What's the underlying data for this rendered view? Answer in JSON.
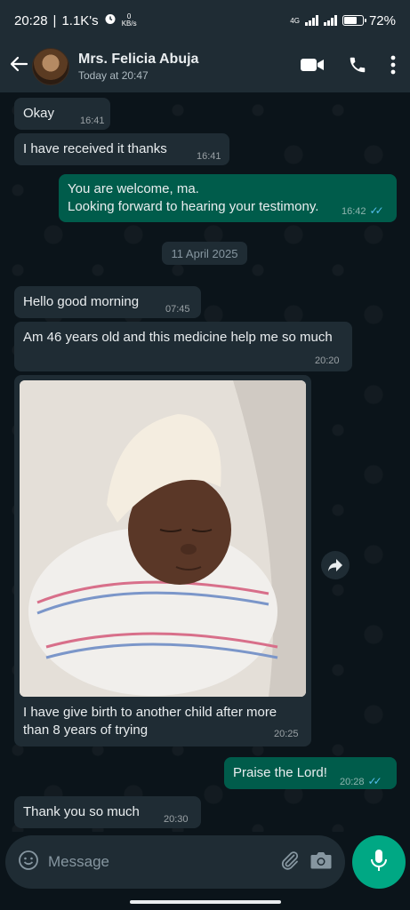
{
  "status_bar": {
    "time": "20:28",
    "separator": "|",
    "followers": "1.1K's",
    "speed_value": "0",
    "speed_unit": "KB/s",
    "network": "4G",
    "battery": "72%",
    "battery_level": 0.72
  },
  "header": {
    "contact_name": "Mrs. Felicia Abuja",
    "last_seen": "Today at 20:47"
  },
  "messages": [
    {
      "direction": "in",
      "text": "Okay",
      "time": "16:41"
    },
    {
      "direction": "in",
      "text": "I have received it thanks",
      "time": "16:41"
    },
    {
      "direction": "out",
      "lines": [
        "You are welcome, ma.",
        "Looking forward to hearing your testimony."
      ],
      "time": "16:42",
      "status": "read"
    },
    {
      "direction": "in",
      "text": "Hello good morning",
      "time": "07:45"
    },
    {
      "direction": "in",
      "text": "Am 46 years old and this medicine help me so much",
      "time": "20:20"
    },
    {
      "direction": "in",
      "type": "image",
      "caption_lines": [
        "I have give birth to another child after more",
        "than 8 years of trying"
      ],
      "time": "20:25"
    },
    {
      "direction": "out",
      "text": "Praise the Lord!",
      "time": "20:28",
      "status": "read"
    },
    {
      "direction": "in",
      "text": "Thank you so much",
      "time": "20:30"
    }
  ],
  "date_separator": "11 April 2025",
  "composer": {
    "placeholder": "Message"
  },
  "colors": {
    "incoming_bubble": "#1f2c34",
    "outgoing_bubble": "#005c4b",
    "accent": "#00a884",
    "read_ticks": "#53bdeb"
  },
  "icons": [
    "back-arrow-icon",
    "video-call-icon",
    "phone-icon",
    "more-vertical-icon",
    "alarm-icon",
    "emoji-icon",
    "attach-icon",
    "camera-icon",
    "mic-icon",
    "forward-icon",
    "double-check-icon"
  ]
}
